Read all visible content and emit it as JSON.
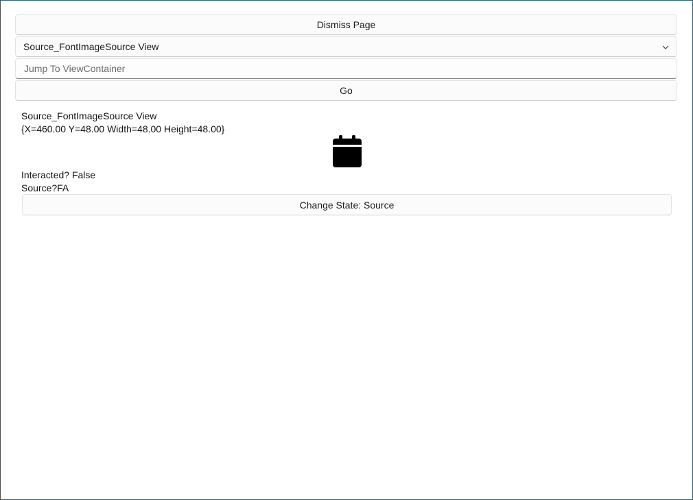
{
  "controls": {
    "dismiss_label": "Dismiss Page",
    "picker_selected": "Source_FontImageSource View",
    "jump_placeholder": "Jump To ViewContainer",
    "jump_value": "",
    "go_label": "Go"
  },
  "view": {
    "name": "Source_FontImageSource View",
    "bounds": "{X=460.00 Y=48.00 Width=48.00 Height=48.00}",
    "icon": "calendar-icon",
    "interacted": "Interacted? False",
    "source": "Source?FA",
    "change_state_label": "Change State: Source"
  },
  "colors": {
    "window_border": "#2b5f6e",
    "button_bg": "#fbfbfb",
    "icon_fill": "#000000"
  }
}
